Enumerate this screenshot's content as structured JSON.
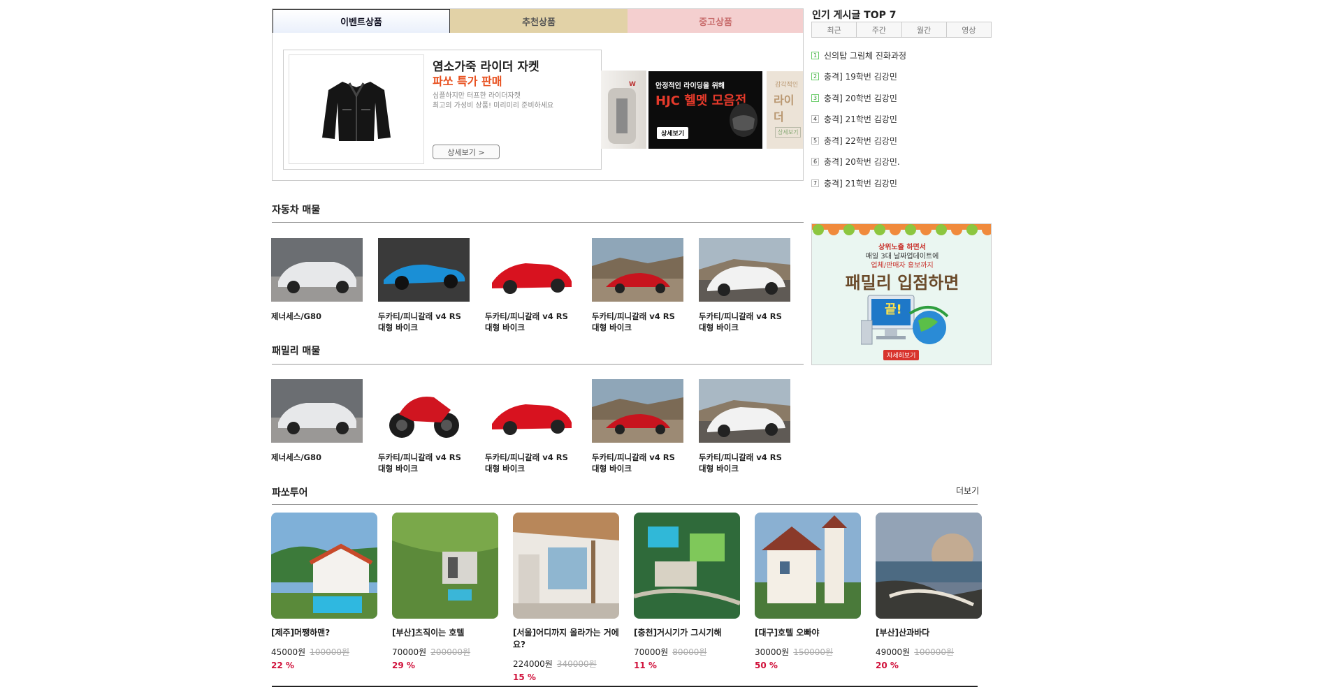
{
  "event_box": {
    "tabs": [
      "이벤트상품",
      "추천상품",
      "중고상품"
    ],
    "promo": {
      "title": "염소가죽 라이더 자켓",
      "subtitle": "파쏘 특가 판매",
      "desc1": "심플하지만 터프한 라이더자켓",
      "desc2": "최고의 가성비 상품! 미리미리 준비하세요",
      "button": "상세보기 >"
    },
    "helmet_banner": {
      "line1": "안정적인 라이딩을 위해",
      "line2": "HJC 헬멧 모음전",
      "button": "상세보기"
    },
    "right_banner": {
      "line1": "감각적인",
      "line2": "라이더",
      "button": "상세보기"
    }
  },
  "popular": {
    "title": "인기 게시글 TOP 7",
    "tabs": [
      "최근",
      "주간",
      "월간",
      "영상"
    ],
    "items": [
      {
        "num": "1",
        "text": "신의탑 그림체 진화과정"
      },
      {
        "num": "2",
        "text": "충격] 19학번 김강민"
      },
      {
        "num": "3",
        "text": "충격] 20학번 김강민"
      },
      {
        "num": "4",
        "text": "충격] 21학번 김강민"
      },
      {
        "num": "5",
        "text": "충격] 22학번 김강민"
      },
      {
        "num": "6",
        "text": "충격] 20학번 김강민."
      },
      {
        "num": "7",
        "text": "충격] 21학번 김강민"
      }
    ]
  },
  "car_section": {
    "title": "자동차 매물",
    "items": [
      {
        "name": "제너세스/G80"
      },
      {
        "name": "두카티/피니갈래 v4 RS 대형 바이크"
      },
      {
        "name": "두카티/피니갈래 v4 RS 대형 바이크"
      },
      {
        "name": "두카티/피니갈래 v4 RS 대형 바이크"
      },
      {
        "name": "두카티/피니갈래 v4 RS 대형 바이크"
      }
    ]
  },
  "family_section": {
    "title": "패밀리 매물",
    "items": [
      {
        "name": "제너세스/G80"
      },
      {
        "name": "두카티/피니갈래 v4 RS 대형 바이크"
      },
      {
        "name": "두카티/피니갈래 v4 RS 대형 바이크"
      },
      {
        "name": "두카티/피니갈래 v4 RS 대형 바이크"
      },
      {
        "name": "두카티/피니갈래 v4 RS 대형 바이크"
      }
    ]
  },
  "side_ad": {
    "line1": "상위노출 하면서",
    "line2": "매일 3대 날짜업데이트에",
    "line3": "업체/판매자 홍보까지",
    "headline": "패밀리 입점하면",
    "bubble": "끝!",
    "button": "자세히보기"
  },
  "tour_section": {
    "title": "파쏘투어",
    "more": "더보기",
    "items": [
      {
        "name": "[제주]머쨍하맨?",
        "price": "45000원",
        "orig": "100000원",
        "disc": "22 %"
      },
      {
        "name": "[부산]츠직이는 호텔",
        "price": "70000원",
        "orig": "200000원",
        "disc": "29 %"
      },
      {
        "name": "[서울]어디까지 올라가는 거에요?",
        "price": "224000원",
        "orig": "340000원",
        "disc": "15 %"
      },
      {
        "name": "[충천]거시기가 그시기해",
        "price": "70000원",
        "orig": "80000원",
        "disc": "11 %"
      },
      {
        "name": "[대구]호텔 오빠야",
        "price": "30000원",
        "orig": "150000원",
        "disc": "50 %"
      },
      {
        "name": "[부산]산과바다",
        "price": "49000원",
        "orig": "100000원",
        "disc": "20 %"
      }
    ]
  }
}
